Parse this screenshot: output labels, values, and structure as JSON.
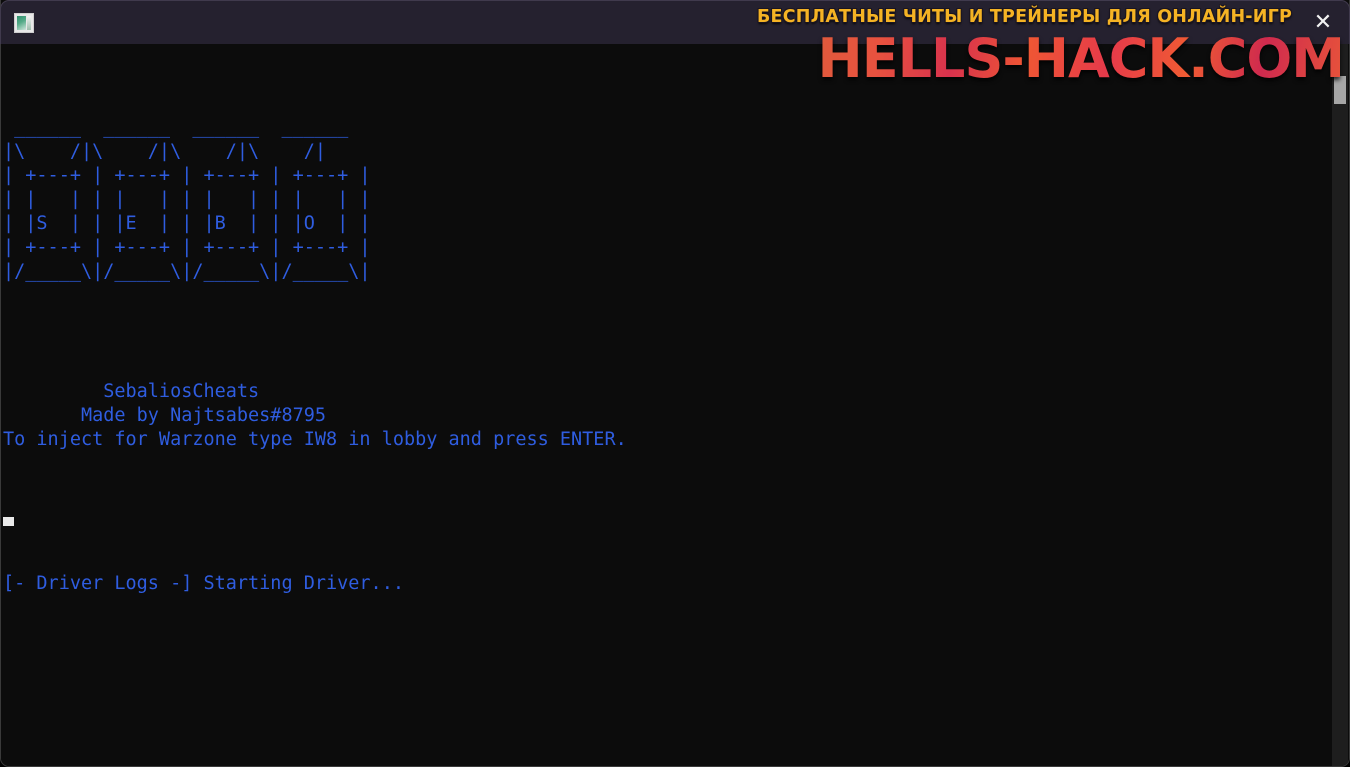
{
  "window": {
    "title": "",
    "icon_name": "terminal-app-icon",
    "close_label": "✕"
  },
  "terminal": {
    "ascii_art": [
      " ______  ______  ______  ______ ",
      "|\\    /|\\    /|\\    /|\\    /|",
      "| +---+ | +---+ | +---+ | +---+ |",
      "| |   | | |   | | |   | | |   | |",
      "| |S  | | |E  | | |B  | | |O  | |",
      "| +---+ | +---+ | +---+ | +---+ |",
      "|/_____\\|/_____\\|/_____\\|/_____\\|"
    ],
    "lines": [
      "",
      "",
      "",
      "",
      "         SebaliosCheats",
      "       Made by Najtsabes#8795",
      "To inject for Warzone type IW8 in lobby and press ENTER.",
      "",
      "",
      "",
      "",
      "",
      "[- Driver Logs -] Starting Driver...",
      "",
      ""
    ],
    "brand": "SebaliosCheats",
    "author": "Made by Najtsabes#8795",
    "instruction": "To inject for Warzone type IW8 in lobby and press ENTER.",
    "log_line": "[- Driver Logs -] Starting Driver...",
    "text_color": "#2f5de0",
    "background_color": "#0c0c0c",
    "cursor_color": "#e9e9e9"
  },
  "scrollbar": {
    "name": "vertical-scrollbar",
    "thumb_position_pct": 4
  },
  "watermark": {
    "tagline": "БЕСПЛАТНЫЕ ЧИТЫ И ТРЕЙНЕРЫ ДЛЯ ОНЛАЙН-ИГР",
    "logo": "HELLS-HACK.COM",
    "tagline_color": "#f5b324",
    "logo_color": "#e0463f"
  }
}
